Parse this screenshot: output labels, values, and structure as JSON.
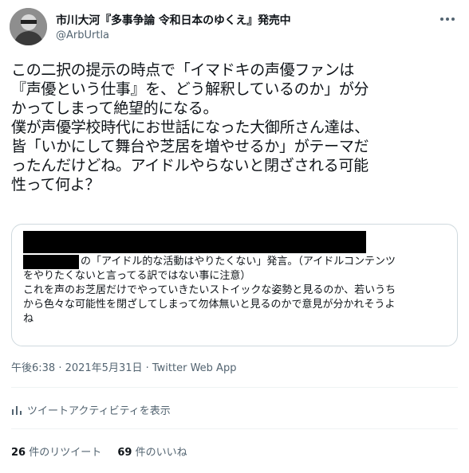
{
  "user": {
    "display_name": "市川大河『多事争論 令和日本のゆくえ』発売中",
    "handle": "@ArbUrtla"
  },
  "tweet": {
    "lines": [
      "この二択の提示の時点で「イマドキの声優ファンは",
      "『声優という仕事』を、どう解釈しているのか」が分",
      "かってしまって絶望的になる。",
      "僕が声優学校時代にお世話になった大御所さん達は、",
      "皆「いかにして舞台や芝居を増やせるか」がテーマだ",
      "ったんだけどね。アイドルやらないと閉ざされる可能",
      "性って何よ？"
    ]
  },
  "quote": {
    "line1_suffix": "の「アイドル的な活動はやりたくない」発言。（アイドルコンテンツ",
    "lines": [
      "をやりたくないと言ってる訳ではない事に注意）",
      "これを声のお芝居だけでやっていきたいストイックな姿勢と見るのか、若いうち",
      "から色々な可能性を閉ざしてしまって勿体無いと見るのかで意見が分かれそうよ",
      "ね"
    ]
  },
  "meta": {
    "timestamp": "午後6:38 · 2021年5月31日 · Twitter Web App",
    "activity_label": "ツイートアクティビティを表示"
  },
  "stats": {
    "retweets_count": "26",
    "retweets_label": "件のリツイート",
    "likes_count": "69",
    "likes_label": "件のいいね"
  },
  "colors": {
    "secondary_text": "#536471",
    "border": "#cfd9de",
    "divider": "#eff3f4"
  },
  "icons": {
    "more": "more-horizontal-icon",
    "activity": "bar-chart-icon"
  }
}
